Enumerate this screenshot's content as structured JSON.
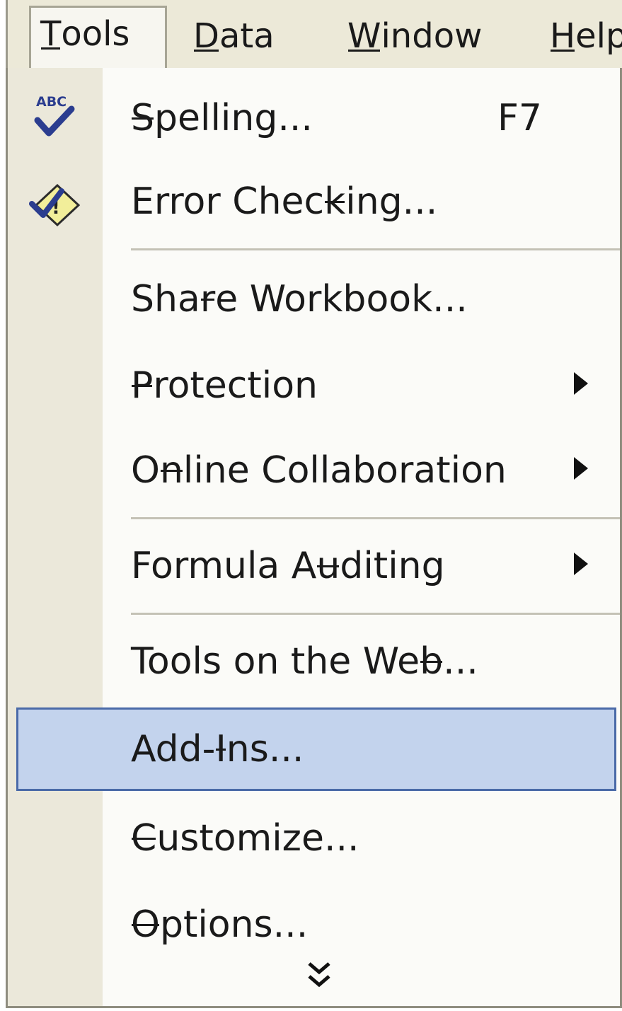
{
  "menubar": {
    "items": [
      {
        "label": "Tools",
        "mnemonic_index": 0,
        "open": true
      },
      {
        "label": "Data",
        "mnemonic_index": 0
      },
      {
        "label": "Window",
        "mnemonic_index": 0
      },
      {
        "label": "Help",
        "mnemonic_index": 0
      }
    ]
  },
  "menu": {
    "items": [
      {
        "label": "Spelling...",
        "shortcut": "F7",
        "icon": "spelling-abc-check-icon"
      },
      {
        "label": "Error Checking...",
        "icon": "error-checking-icon"
      },
      {
        "label": "Share Workbook..."
      },
      {
        "label": "Protection",
        "submenu": true
      },
      {
        "label": "Online Collaboration",
        "submenu": true
      },
      {
        "label": "Formula Auditing",
        "submenu": true
      },
      {
        "label": "Tools on the Web..."
      },
      {
        "label": "Add-Ins...",
        "highlighted": true
      },
      {
        "label": "Customize..."
      },
      {
        "label": "Options..."
      }
    ],
    "expand_icon": "double-chevron-down-icon"
  },
  "colors": {
    "menubar_bg": "#ece9d8",
    "icon_strip": "#ebe8da",
    "menu_bg": "#fbfbf8",
    "highlight_fill": "#c3d3ed",
    "highlight_border": "#4a6aa8",
    "checkmark": "#2b3d8f",
    "warning_diamond": "#f2ee9a"
  }
}
